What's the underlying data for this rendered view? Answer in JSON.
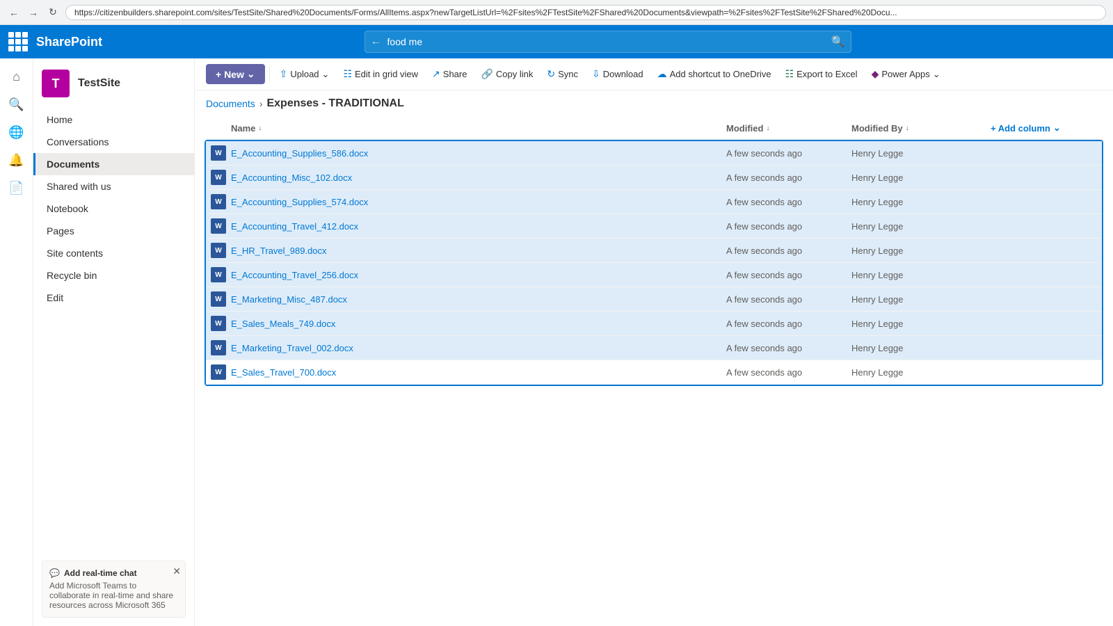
{
  "browser": {
    "url": "https://citizenbuilders.sharepoint.com/sites/TestSite/Shared%20Documents/Forms/AllItems.aspx?newTargetListUrl=%2Fsites%2FTestSite%2FShared%20Documents&viewpath=%2Fsites%2FTestSite%2FShared%20Docu..."
  },
  "topbar": {
    "logo": "SharePoint",
    "search_value": "food me",
    "search_placeholder": "Search"
  },
  "site": {
    "icon_letter": "T",
    "name": "TestSite"
  },
  "nav": {
    "items": [
      {
        "label": "Home",
        "active": false
      },
      {
        "label": "Conversations",
        "active": false
      },
      {
        "label": "Documents",
        "active": true
      },
      {
        "label": "Shared with us",
        "active": false
      },
      {
        "label": "Notebook",
        "active": false
      },
      {
        "label": "Pages",
        "active": false
      },
      {
        "label": "Site contents",
        "active": false
      },
      {
        "label": "Recycle bin",
        "active": false
      },
      {
        "label": "Edit",
        "active": false
      }
    ]
  },
  "toolbar": {
    "new_label": "+ New",
    "upload_label": "Upload",
    "edit_grid_label": "Edit in grid view",
    "share_label": "Share",
    "copy_link_label": "Copy link",
    "sync_label": "Sync",
    "download_label": "Download",
    "add_shortcut_label": "Add shortcut to OneDrive",
    "export_excel_label": "Export to Excel",
    "power_apps_label": "Power Apps"
  },
  "breadcrumb": {
    "parent": "Documents",
    "current": "Expenses - TRADITIONAL"
  },
  "table": {
    "columns": {
      "name": "Name",
      "modified": "Modified",
      "modified_by": "Modified By",
      "add_column": "+ Add column"
    },
    "files": [
      {
        "name": "E_Accounting_Supplies_586.docx",
        "modified": "A few seconds ago",
        "modified_by": "Henry Legge",
        "selected": true
      },
      {
        "name": "E_Accounting_Misc_102.docx",
        "modified": "A few seconds ago",
        "modified_by": "Henry Legge",
        "selected": true
      },
      {
        "name": "E_Accounting_Supplies_574.docx",
        "modified": "A few seconds ago",
        "modified_by": "Henry Legge",
        "selected": true
      },
      {
        "name": "E_Accounting_Travel_412.docx",
        "modified": "A few seconds ago",
        "modified_by": "Henry Legge",
        "selected": true
      },
      {
        "name": "E_HR_Travel_989.docx",
        "modified": "A few seconds ago",
        "modified_by": "Henry Legge",
        "selected": true
      },
      {
        "name": "E_Accounting_Travel_256.docx",
        "modified": "A few seconds ago",
        "modified_by": "Henry Legge",
        "selected": true
      },
      {
        "name": "E_Marketing_Misc_487.docx",
        "modified": "A few seconds ago",
        "modified_by": "Henry Legge",
        "selected": true
      },
      {
        "name": "E_Sales_Meals_749.docx",
        "modified": "A few seconds ago",
        "modified_by": "Henry Legge",
        "selected": true
      },
      {
        "name": "E_Marketing_Travel_002.docx",
        "modified": "A few seconds ago",
        "modified_by": "Henry Legge",
        "selected": true
      },
      {
        "name": "E_Sales_Travel_700.docx",
        "modified": "A few seconds ago",
        "modified_by": "Henry Legge",
        "selected": false
      }
    ]
  },
  "chat_promo": {
    "title": "Add real-time chat",
    "description": "Add Microsoft Teams to collaborate in real-time and share resources across Microsoft 365"
  }
}
